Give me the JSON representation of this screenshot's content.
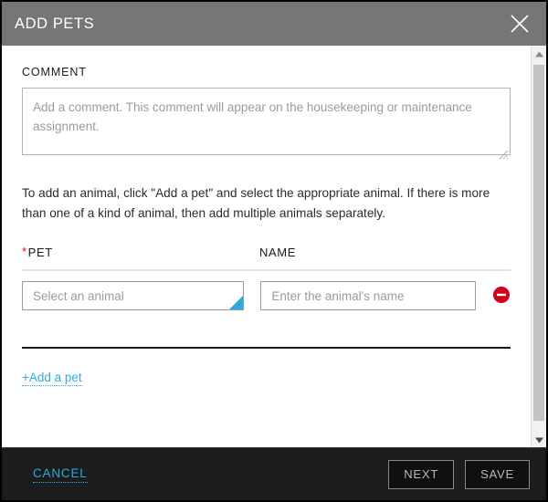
{
  "modal": {
    "title": "ADD PETS",
    "close_icon": "close-icon"
  },
  "comment": {
    "label": "COMMENT",
    "placeholder": "Add a comment. This comment will appear on the housekeeping or maintenance assignment.",
    "value": ""
  },
  "helper_text": "To add an animal, click \"Add a pet\" and select the appropriate animal. If there is more than one of a kind of animal, then add multiple animals separately.",
  "columns": {
    "pet_label": "PET",
    "pet_required_marker": "*",
    "name_label": "NAME"
  },
  "pet_rows": [
    {
      "pet_select_value": "Select an animal",
      "name_value": "",
      "name_placeholder": "Enter the animal's name",
      "remove_icon": "minus-circle-icon"
    }
  ],
  "add_pet_link": "+Add a pet",
  "footer": {
    "cancel_label": "CANCEL",
    "next_label": "NEXT",
    "save_label": "SAVE"
  },
  "scrollbar": {
    "up_icon": "caret-up-icon",
    "down_icon": "caret-down-icon"
  },
  "colors": {
    "header_bg": "#767676",
    "footer_bg": "#1c1c1c",
    "accent_cyan": "#29abe2",
    "required_red": "#ff0000",
    "remove_red": "#d0021b",
    "border_gray": "#9b9b9b",
    "placeholder_gray": "#9b9b9b"
  }
}
